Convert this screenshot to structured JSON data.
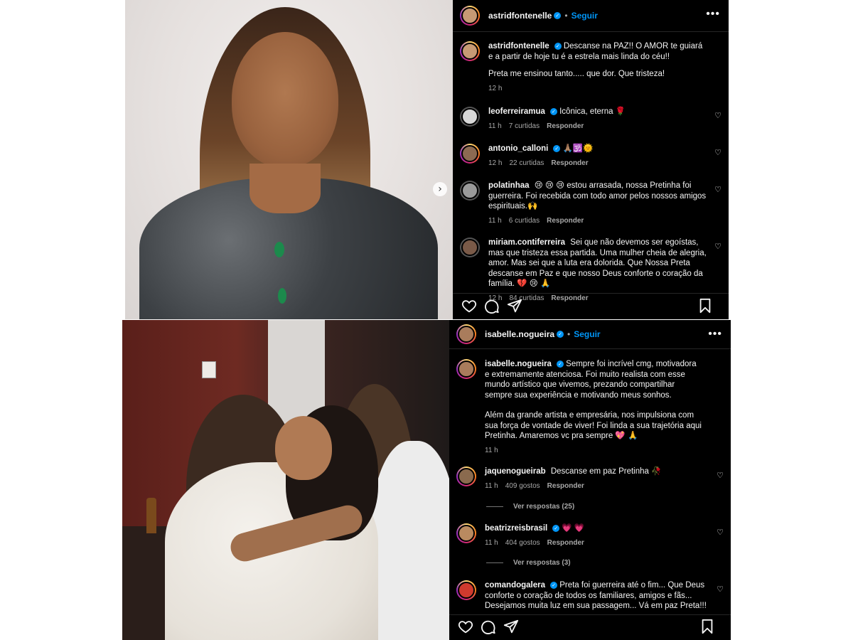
{
  "post1": {
    "author": "astridfontenelle",
    "follow_label": "Seguir",
    "caption_user": "astridfontenelle",
    "caption_p1": "Descanse na PAZ!! O AMOR te guiará e a partir de hoje tu é a estrela mais linda do céu!!",
    "caption_p2": "Preta me ensinou tanto..... que dor. Que tristeza!",
    "caption_time": "12 h",
    "comments": [
      {
        "user": "leoferreiramua",
        "text": "Icônica, eterna 🌹",
        "time": "11 h",
        "likes": "7 curtidas",
        "reply": "Responder"
      },
      {
        "user": "antonio_calloni",
        "text": "🙏🏽🕉️🌞",
        "time": "12 h",
        "likes": "22 curtidas",
        "reply": "Responder"
      },
      {
        "user": "polatinhaa",
        "text": "😢 😢 😢 estou arrasada, nossa Pretinha foi guerreira. Foi recebida com todo amor pelos nossos amigos espirituais.🙌",
        "time": "11 h",
        "likes": "6 curtidas",
        "reply": "Responder"
      },
      {
        "user": "miriam.contiferreira",
        "text": "Sei que não devemos ser egoístas, mas que tristeza essa partida. Uma mulher cheia de alegria, amor. Mas sei que a luta era dolorida. Que Nossa Preta descanse em Paz e que nosso Deus conforte o coração da família. 💔 😢 🙏",
        "time": "12 h",
        "likes": "84 curtidas",
        "reply": "Responder"
      }
    ]
  },
  "post2": {
    "author": "isabelle.nogueira",
    "follow_label": "Seguir",
    "caption_user": "isabelle.nogueira",
    "caption_p1": "Sempre foi incrível cmg, motivadora e extremamente atenciosa. Foi muito realista com esse mundo artístico que vivemos, prezando compartilhar sempre sua experiência e motivando meus sonhos.",
    "caption_p2": "Além da grande artista e empresária, nos impulsiona com sua força de vontade de viver! Foi linda a sua trajetória aqui Pretinha. Amaremos vc pra sempre 💖 🙏",
    "caption_time": "11 h",
    "comments": [
      {
        "user": "jaquenogueirab",
        "text": "Descanse em paz Pretinha 🥀",
        "time": "11 h",
        "likes": "409 gostos",
        "reply": "Responder",
        "view_replies": "Ver respostas (25)"
      },
      {
        "user": "beatrizreisbrasil",
        "text": "💗 💗",
        "time": "11 h",
        "likes": "404 gostos",
        "reply": "Responder",
        "view_replies": "Ver respostas (3)"
      },
      {
        "user": "comandogalera",
        "text": "Preta foi guerreira até o fim... Que Deus conforte o coração de todos os familiares, amigos e fãs... Desejamos muita luz em sua passagem... Vá em paz Preta!!!"
      }
    ]
  },
  "icons": {
    "more": "•••",
    "verified": "✓",
    "heart_small": "♡",
    "next": "›"
  },
  "colors": {
    "background": "#000000",
    "link_blue": "#0095f6",
    "muted": "#a8a8a8"
  }
}
